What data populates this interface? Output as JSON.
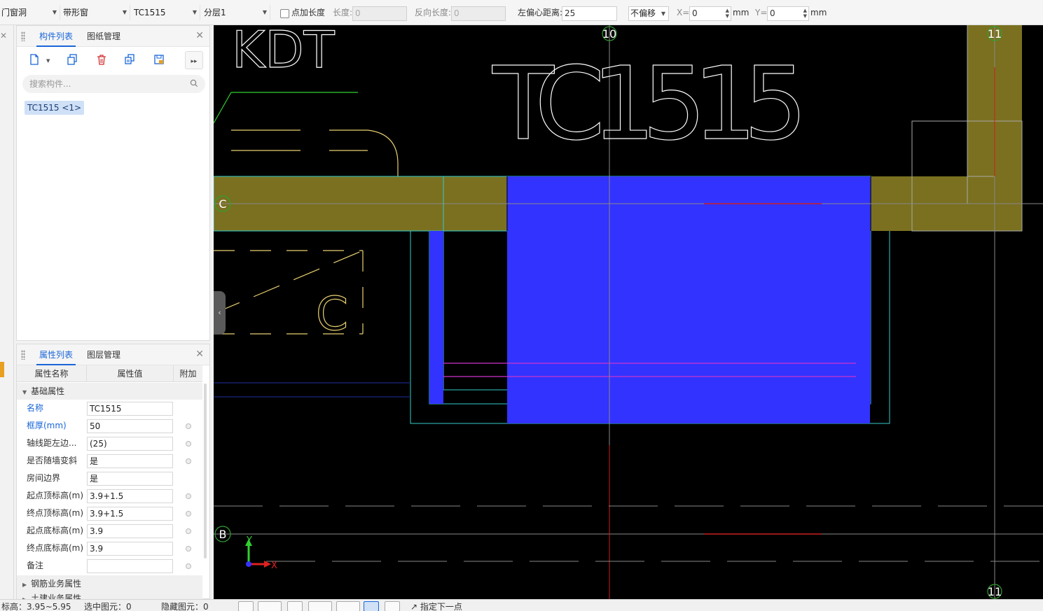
{
  "toolbar": {
    "category": "门窗洞",
    "type": "带形窗",
    "component": "TC1515",
    "layer": "分层1",
    "add_length_label": "点加长度",
    "length_label": "长度:",
    "length_value": "0",
    "reverse_length_label": "反向长度:",
    "reverse_length_value": "0",
    "offset_label": "左偏心距离:",
    "offset_value": "25",
    "offset_mode": "不偏移",
    "x_label": "X=",
    "x_value": "0",
    "x_unit": "mm",
    "y_label": "Y=",
    "y_value": "0",
    "y_unit": "mm"
  },
  "component_panel": {
    "tabs": [
      "构件列表",
      "图纸管理"
    ],
    "search_placeholder": "搜索构件...",
    "items": [
      "TC1515 <1>"
    ]
  },
  "property_panel": {
    "tabs": [
      "属性列表",
      "图层管理"
    ],
    "headers": [
      "属性名称",
      "属性值",
      "附加"
    ],
    "group_basic": "基础属性",
    "rows": [
      {
        "name": "名称",
        "value": "TC1515"
      },
      {
        "name": "框厚(mm)",
        "value": "50"
      },
      {
        "name": "轴线距左边...",
        "value": "(25)"
      },
      {
        "name": "是否随墙变斜",
        "value": "是"
      },
      {
        "name": "房间边界",
        "value": "是"
      },
      {
        "name": "起点顶标高(m)",
        "value": "3.9+1.5"
      },
      {
        "name": "终点顶标高(m)",
        "value": "3.9+1.5"
      },
      {
        "name": "起点底标高(m)",
        "value": "3.9"
      },
      {
        "name": "终点底标高(m)",
        "value": "3.9"
      },
      {
        "name": "备注",
        "value": ""
      }
    ],
    "group_rebar": "钢筋业务属性",
    "group_civil": "土建业务属性"
  },
  "canvas": {
    "big_label": "TC1515",
    "partial_label": "KDT",
    "axis_top_10": "10",
    "axis_top_11": "11",
    "axis_bottom_11": "11",
    "axis_c": "C",
    "axis_b": "B",
    "ucs_y": "Y",
    "ucs_x": "X",
    "door_letter": "C",
    "colors": {
      "wall": "#7a7020",
      "window": "#3333ff",
      "cyan": "#33cccc",
      "axis": "#888888"
    }
  },
  "statusbar": {
    "coords": "标高：3.95~5.95",
    "selected": "选中图元：0",
    "hidden": "隐藏图元：0",
    "hint": "指定下一点"
  }
}
